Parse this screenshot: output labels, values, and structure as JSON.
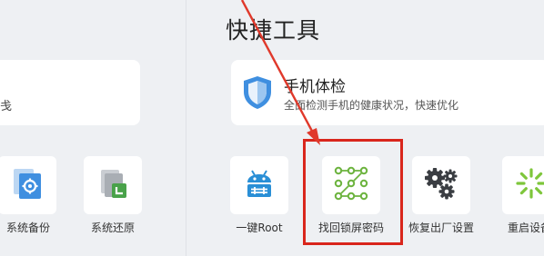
{
  "section_title": "快捷工具",
  "left_card": {
    "text_fragment": "戋"
  },
  "feature_card": {
    "title": "手机体检",
    "description": "全面检测手机的健康状况，快速优化",
    "icon": "shield-icon"
  },
  "left_tools": [
    {
      "label": "系统备份",
      "icon": "system-backup-icon"
    },
    {
      "label": "系统还原",
      "icon": "system-restore-icon"
    }
  ],
  "right_tools": [
    {
      "label": "一键Root",
      "icon": "android-root-icon"
    },
    {
      "label": "找回锁屏密码",
      "icon": "pattern-lock-icon"
    },
    {
      "label": "恢复出厂设置",
      "icon": "gears-icon"
    },
    {
      "label": "重启设备",
      "icon": "restart-icon"
    }
  ],
  "colors": {
    "accent_blue": "#3f8fe0",
    "android_blue": "#2a8fd6",
    "pattern_green": "#6cb33e",
    "restart_green": "#7ec63b",
    "highlight_red": "#d9261c",
    "arrow_red": "#e0392b"
  }
}
